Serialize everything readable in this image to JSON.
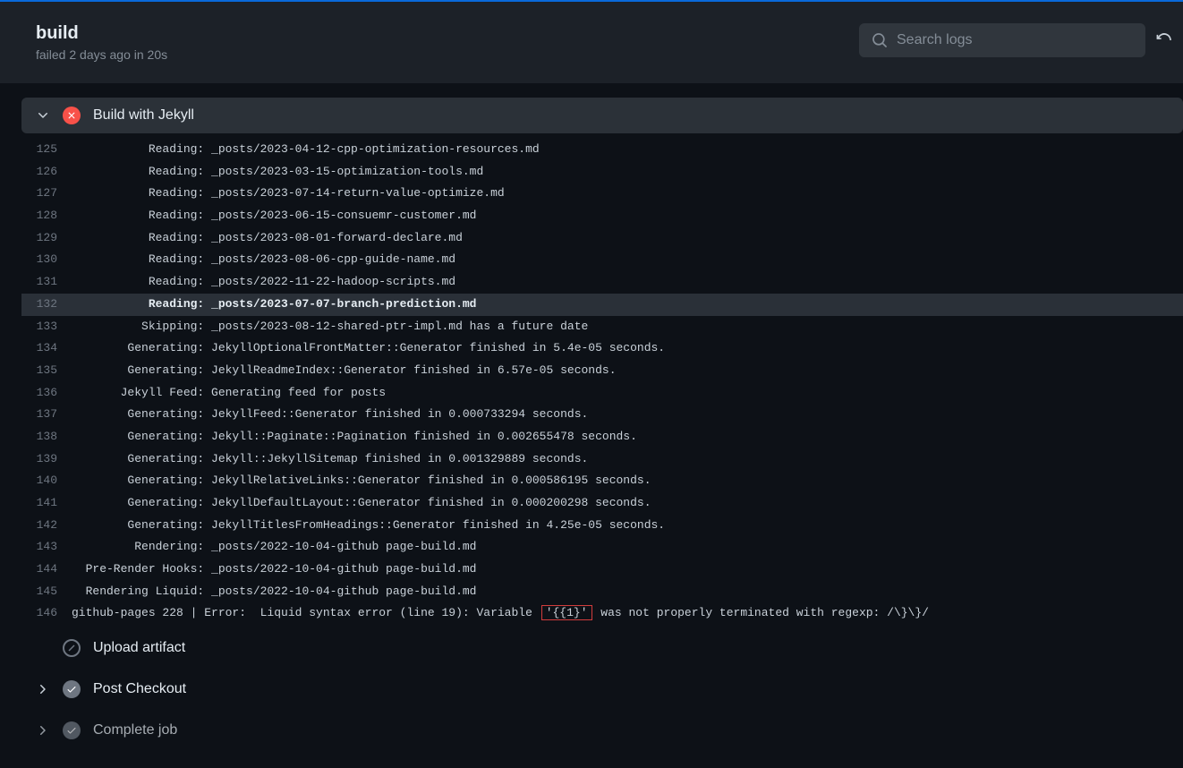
{
  "header": {
    "title": "build",
    "status_text": "failed 2 days ago in 20s",
    "search_placeholder": "Search logs"
  },
  "steps": {
    "current": {
      "name": "Build with Jekyll"
    },
    "upload": {
      "name": "Upload artifact"
    },
    "post_checkout": {
      "name": "Post Checkout"
    },
    "complete": {
      "name": "Complete job"
    }
  },
  "log": {
    "lines": [
      {
        "num": 125,
        "indent": "           ",
        "label": "Reading: ",
        "rest": "_posts/2023-04-12-cpp-optimization-resources.md"
      },
      {
        "num": 126,
        "indent": "           ",
        "label": "Reading: ",
        "rest": "_posts/2023-03-15-optimization-tools.md"
      },
      {
        "num": 127,
        "indent": "           ",
        "label": "Reading: ",
        "rest": "_posts/2023-07-14-return-value-optimize.md"
      },
      {
        "num": 128,
        "indent": "           ",
        "label": "Reading: ",
        "rest": "_posts/2023-06-15-consuemr-customer.md"
      },
      {
        "num": 129,
        "indent": "           ",
        "label": "Reading: ",
        "rest": "_posts/2023-08-01-forward-declare.md"
      },
      {
        "num": 130,
        "indent": "           ",
        "label": "Reading: ",
        "rest": "_posts/2023-08-06-cpp-guide-name.md"
      },
      {
        "num": 131,
        "indent": "           ",
        "label": "Reading: ",
        "rest": "_posts/2022-11-22-hadoop-scripts.md"
      },
      {
        "num": 132,
        "indent": "           ",
        "label": "Reading: ",
        "rest": "_posts/2023-07-07-branch-prediction.md",
        "highlighted": true
      },
      {
        "num": 133,
        "indent": "          ",
        "label": "Skipping: ",
        "rest": "_posts/2023-08-12-shared-ptr-impl.md has a future date"
      },
      {
        "num": 134,
        "indent": "        ",
        "label": "Generating: ",
        "rest": "JekyllOptionalFrontMatter::Generator finished in 5.4e-05 seconds."
      },
      {
        "num": 135,
        "indent": "        ",
        "label": "Generating: ",
        "rest": "JekyllReadmeIndex::Generator finished in 6.57e-05 seconds."
      },
      {
        "num": 136,
        "indent": "       ",
        "label": "Jekyll Feed: ",
        "rest": "Generating feed for posts"
      },
      {
        "num": 137,
        "indent": "        ",
        "label": "Generating: ",
        "rest": "JekyllFeed::Generator finished in 0.000733294 seconds."
      },
      {
        "num": 138,
        "indent": "        ",
        "label": "Generating: ",
        "rest": "Jekyll::Paginate::Pagination finished in 0.002655478 seconds."
      },
      {
        "num": 139,
        "indent": "        ",
        "label": "Generating: ",
        "rest": "Jekyll::JekyllSitemap finished in 0.001329889 seconds."
      },
      {
        "num": 140,
        "indent": "        ",
        "label": "Generating: ",
        "rest": "JekyllRelativeLinks::Generator finished in 0.000586195 seconds."
      },
      {
        "num": 141,
        "indent": "        ",
        "label": "Generating: ",
        "rest": "JekyllDefaultLayout::Generator finished in 0.000200298 seconds."
      },
      {
        "num": 142,
        "indent": "        ",
        "label": "Generating: ",
        "rest": "JekyllTitlesFromHeadings::Generator finished in 4.25e-05 seconds."
      },
      {
        "num": 143,
        "indent": "         ",
        "label": "Rendering: ",
        "rest": "_posts/2022-10-04-github page-build.md"
      },
      {
        "num": 144,
        "indent": "  ",
        "label": "Pre-Render Hooks: ",
        "rest": "_posts/2022-10-04-github page-build.md"
      },
      {
        "num": 145,
        "indent": "  ",
        "label": "Rendering Liquid: ",
        "rest": "_posts/2022-10-04-github page-build.md"
      }
    ],
    "error_line": {
      "num": 146,
      "prefix": "github-pages 228 | Error:  Liquid syntax error (line 19): Variable ",
      "boxed": "'{{1}'",
      "suffix": " was not properly terminated with regexp: /\\}\\}/"
    }
  }
}
